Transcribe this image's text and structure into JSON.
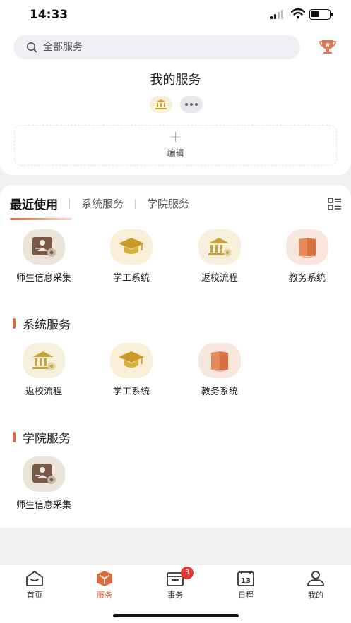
{
  "status": {
    "time": "14:33"
  },
  "search": {
    "placeholder": "全部服务"
  },
  "my_services": {
    "title": "我的服务",
    "edit_label": "编辑"
  },
  "tabs": [
    "最近使用",
    "系统服务",
    "学院服务"
  ],
  "recent": [
    {
      "label": "师生信息采集",
      "icon": "person-card-icon"
    },
    {
      "label": "学工系统",
      "icon": "graduation-cap-icon"
    },
    {
      "label": "返校流程",
      "icon": "bank-building-icon"
    },
    {
      "label": "教务系统",
      "icon": "book-icon"
    }
  ],
  "system_services": {
    "title": "系统服务",
    "items": [
      {
        "label": "返校流程",
        "icon": "bank-building-icon"
      },
      {
        "label": "学工系统",
        "icon": "graduation-cap-icon"
      },
      {
        "label": "教务系统",
        "icon": "book-icon"
      }
    ]
  },
  "college_services": {
    "title": "学院服务",
    "items": [
      {
        "label": "师生信息采集",
        "icon": "person-card-icon"
      }
    ]
  },
  "tabbar": {
    "items": [
      {
        "label": "首页",
        "icon": "home-icon"
      },
      {
        "label": "服务",
        "icon": "service-box-icon"
      },
      {
        "label": "事务",
        "icon": "tasks-icon",
        "badge": "3"
      },
      {
        "label": "日程",
        "icon": "calendar-icon",
        "date": "13"
      },
      {
        "label": "我的",
        "icon": "profile-icon"
      }
    ]
  },
  "colors": {
    "accent": "#e0693a",
    "badge": "#e53935"
  }
}
